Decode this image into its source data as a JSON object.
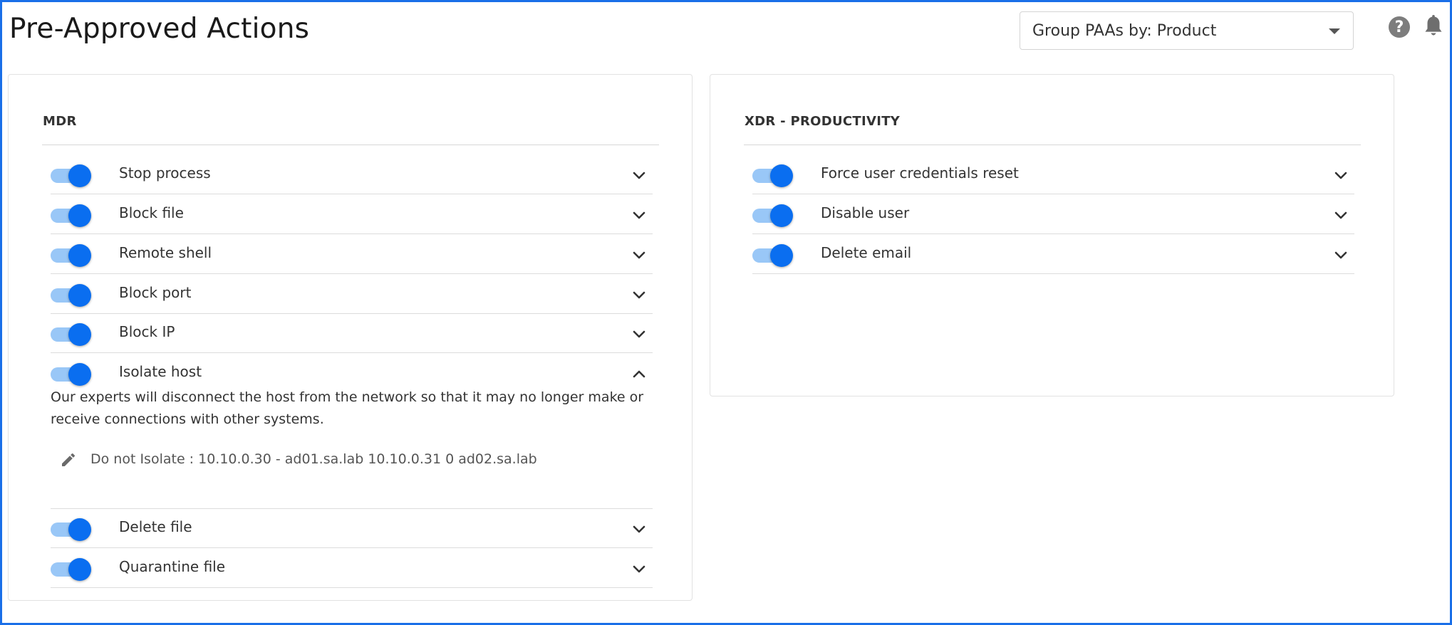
{
  "page": {
    "title": "Pre-Approved Actions"
  },
  "group_select": {
    "label": "Group PAAs by: Product"
  },
  "header_icons": [
    "help-icon",
    "bell-icon"
  ],
  "colors": {
    "accent": "#0a6ef0",
    "toggle_track": "#99c7f7",
    "frame": "#1a6fe8"
  },
  "mdr": {
    "heading": "MDR",
    "items": [
      {
        "label": "Stop process",
        "enabled": true,
        "expanded": false
      },
      {
        "label": "Block file",
        "enabled": true,
        "expanded": false
      },
      {
        "label": "Remote shell",
        "enabled": true,
        "expanded": false
      },
      {
        "label": "Block port",
        "enabled": true,
        "expanded": false
      },
      {
        "label": "Block IP",
        "enabled": true,
        "expanded": false
      },
      {
        "label": "Isolate host",
        "enabled": true,
        "expanded": true
      },
      {
        "label": "Delete file",
        "enabled": true,
        "expanded": false
      },
      {
        "label": "Quarantine file",
        "enabled": true,
        "expanded": false
      }
    ],
    "isolate_host": {
      "description": "Our experts will disconnect the host from the network so that it may no longer make or receive connections with other systems.",
      "exception": "Do not Isolate : 10.10.0.30 - ad01.sa.lab 10.10.0.31 0 ad02.sa.lab"
    }
  },
  "xdr": {
    "heading": "XDR - PRODUCTIVITY",
    "items": [
      {
        "label": "Force user credentials reset",
        "enabled": true,
        "expanded": false
      },
      {
        "label": "Disable user",
        "enabled": true,
        "expanded": false
      },
      {
        "label": "Delete email",
        "enabled": true,
        "expanded": false
      }
    ]
  }
}
